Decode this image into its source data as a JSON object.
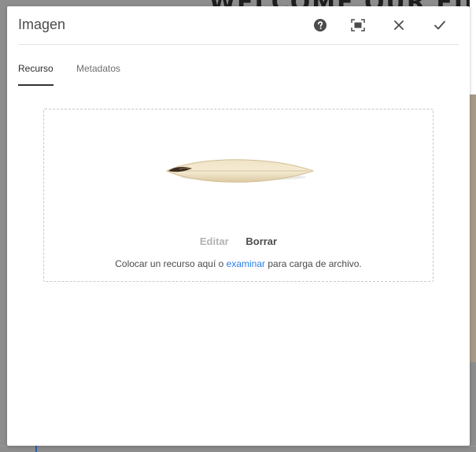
{
  "background": {
    "heading": "WELCOME OUR FINEST B"
  },
  "dialog": {
    "title": "Imagen",
    "buttons": {
      "help": "help-icon",
      "fullscreen": "fullscreen-icon",
      "close": "close-icon",
      "confirm": "checkmark-icon"
    },
    "tabs": [
      {
        "label": "Recurso",
        "active": true
      },
      {
        "label": "Metadatos",
        "active": false
      }
    ],
    "dropzone": {
      "image": "surfboard image",
      "edit_label": "Editar",
      "delete_label": "Borrar",
      "hint_before": "Colocar un recurso aquí o ",
      "hint_link": "examinar",
      "hint_after": " para carga de archivo."
    }
  },
  "colors": {
    "accent": "#2680eb",
    "tab_underline": "#323232",
    "disabled_text": "#b3b3b3"
  }
}
